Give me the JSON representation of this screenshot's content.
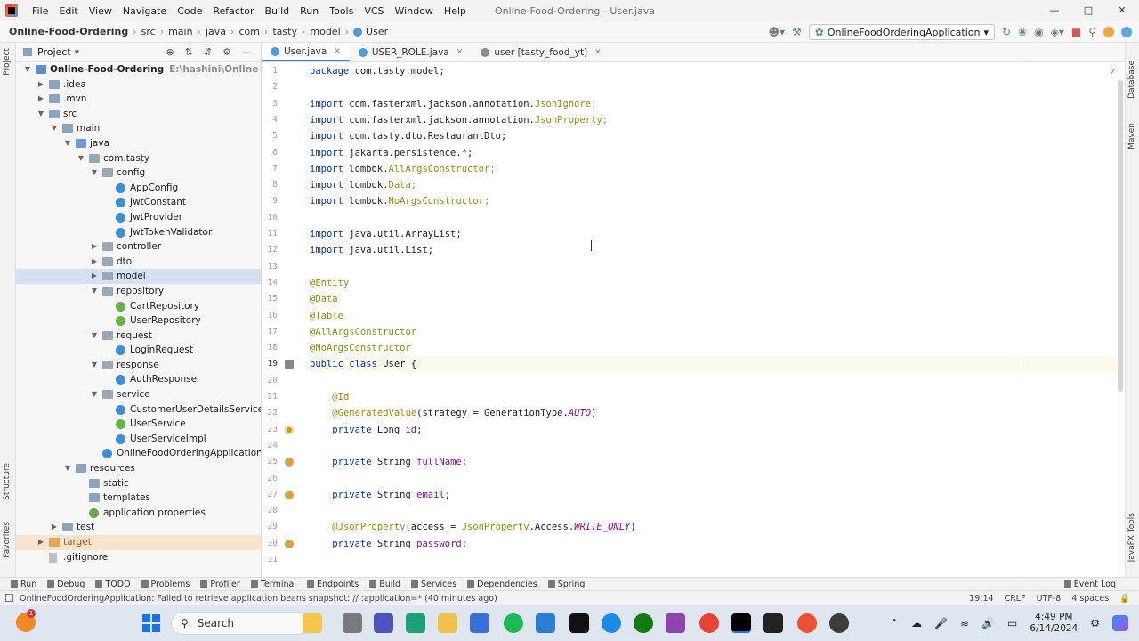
{
  "menu": [
    "File",
    "Edit",
    "View",
    "Navigate",
    "Code",
    "Refactor",
    "Build",
    "Run",
    "Tools",
    "VCS",
    "Window",
    "Help"
  ],
  "window_title": "Online-Food-Ordering - User.java",
  "breadcrumb": [
    "Online-Food-Ordering",
    "src",
    "main",
    "java",
    "com",
    "tasty",
    "model",
    "User"
  ],
  "run_config": "OnlineFoodOrderingApplication",
  "project_panel": {
    "title": "Project",
    "tree": [
      {
        "label": "Online-Food-Ordering",
        "hint": "E:\\hashini\\Online-Food-Orde",
        "depth": 0,
        "arrow": "open",
        "icon": "module",
        "bold": true
      },
      {
        "label": ".idea",
        "depth": 1,
        "arrow": "closed",
        "icon": "folder"
      },
      {
        "label": ".mvn",
        "depth": 1,
        "arrow": "closed",
        "icon": "folder"
      },
      {
        "label": "src",
        "depth": 1,
        "arrow": "open",
        "icon": "folder"
      },
      {
        "label": "main",
        "depth": 2,
        "arrow": "open",
        "icon": "folder"
      },
      {
        "label": "java",
        "depth": 3,
        "arrow": "open",
        "icon": "folder-blue"
      },
      {
        "label": "com.tasty",
        "depth": 4,
        "arrow": "open",
        "icon": "pkg"
      },
      {
        "label": "config",
        "depth": 5,
        "arrow": "open",
        "icon": "pkg"
      },
      {
        "label": "AppConfig",
        "depth": 6,
        "icon": "java"
      },
      {
        "label": "JwtConstant",
        "depth": 6,
        "icon": "java"
      },
      {
        "label": "JwtProvider",
        "depth": 6,
        "icon": "java"
      },
      {
        "label": "JwtTokenValidator",
        "depth": 6,
        "icon": "java"
      },
      {
        "label": "controller",
        "depth": 5,
        "arrow": "closed",
        "icon": "pkg"
      },
      {
        "label": "dto",
        "depth": 5,
        "arrow": "closed",
        "icon": "pkg"
      },
      {
        "label": "model",
        "depth": 5,
        "arrow": "closed",
        "icon": "pkg",
        "selected": true
      },
      {
        "label": "repository",
        "depth": 5,
        "arrow": "open",
        "icon": "pkg"
      },
      {
        "label": "CartRepository",
        "depth": 6,
        "icon": "iface"
      },
      {
        "label": "UserRepository",
        "depth": 6,
        "icon": "iface"
      },
      {
        "label": "request",
        "depth": 5,
        "arrow": "open",
        "icon": "pkg"
      },
      {
        "label": "LoginRequest",
        "depth": 6,
        "icon": "java"
      },
      {
        "label": "response",
        "depth": 5,
        "arrow": "open",
        "icon": "pkg"
      },
      {
        "label": "AuthResponse",
        "depth": 6,
        "icon": "java"
      },
      {
        "label": "service",
        "depth": 5,
        "arrow": "open",
        "icon": "pkg"
      },
      {
        "label": "CustomerUserDetailsService",
        "depth": 6,
        "icon": "java"
      },
      {
        "label": "UserService",
        "depth": 6,
        "icon": "iface"
      },
      {
        "label": "UserServiceImpl",
        "depth": 6,
        "icon": "java"
      },
      {
        "label": "OnlineFoodOrderingApplication",
        "depth": 5,
        "icon": "java"
      },
      {
        "label": "resources",
        "depth": 3,
        "arrow": "open",
        "icon": "folder"
      },
      {
        "label": "static",
        "depth": 4,
        "icon": "folder"
      },
      {
        "label": "templates",
        "depth": 4,
        "icon": "folder"
      },
      {
        "label": "application.properties",
        "depth": 4,
        "icon": "leaf"
      },
      {
        "label": "test",
        "depth": 2,
        "arrow": "closed",
        "icon": "folder"
      },
      {
        "label": "target",
        "depth": 1,
        "arrow": "closed",
        "icon": "folder-orange",
        "highlight": true
      },
      {
        "label": ".gitignore",
        "depth": 1,
        "icon": "file"
      }
    ]
  },
  "tabs": [
    {
      "label": "User.java",
      "active": true,
      "icon_color": "#4f9ad6"
    },
    {
      "label": "USER_ROLE.java",
      "active": false,
      "icon_color": "#4f9ad6"
    },
    {
      "label": "user [tasty_food_yt]",
      "active": false,
      "icon_color": "#8c8c8c"
    }
  ],
  "code": {
    "current_line": 19,
    "lines": [
      [
        [
          "kw",
          "package"
        ],
        [
          "p",
          " com.tasty.model;"
        ]
      ],
      [],
      [
        [
          "kw",
          "import"
        ],
        [
          "p",
          " com.fasterxml.jackson.annotation."
        ],
        [
          "ann",
          "JsonIgnore"
        ],
        [
          "grey",
          ";"
        ]
      ],
      [
        [
          "kw",
          "import"
        ],
        [
          "p",
          " com.fasterxml.jackson.annotation."
        ],
        [
          "ann",
          "JsonProperty"
        ],
        [
          "grey",
          ";"
        ]
      ],
      [
        [
          "kw",
          "import"
        ],
        [
          "p",
          " com.tasty.dto.RestaurantDto;"
        ]
      ],
      [
        [
          "kw",
          "import"
        ],
        [
          "p",
          " jakarta.persistence.*;"
        ]
      ],
      [
        [
          "kw",
          "import"
        ],
        [
          "p",
          " lombok."
        ],
        [
          "ann",
          "AllArgsConstructor"
        ],
        [
          "grey",
          ";"
        ]
      ],
      [
        [
          "kw",
          "import"
        ],
        [
          "p",
          " lombok."
        ],
        [
          "ann",
          "Data"
        ],
        [
          "grey",
          ";"
        ]
      ],
      [
        [
          "kw",
          "import"
        ],
        [
          "p",
          " lombok."
        ],
        [
          "ann",
          "NoArgsConstructor"
        ],
        [
          "grey",
          ";"
        ]
      ],
      [],
      [
        [
          "kw",
          "import"
        ],
        [
          "p",
          " java.util.ArrayList;"
        ]
      ],
      [
        [
          "kw",
          "import"
        ],
        [
          "p",
          " java.util.List;"
        ]
      ],
      [],
      [
        [
          "ann",
          "@Entity"
        ]
      ],
      [
        [
          "ann",
          "@Data"
        ]
      ],
      [
        [
          "ann",
          "@Table"
        ]
      ],
      [
        [
          "ann",
          "@AllArgsConstructor"
        ]
      ],
      [
        [
          "ann",
          "@NoArgsConstructor"
        ]
      ],
      [
        [
          "kw",
          "public class "
        ],
        [
          "p",
          "User {"
        ]
      ],
      [],
      [
        [
          "p",
          "    "
        ],
        [
          "ann",
          "@Id"
        ]
      ],
      [
        [
          "p",
          "    "
        ],
        [
          "ann",
          "@GeneratedValue"
        ],
        [
          "p",
          "(strategy = GenerationType."
        ],
        [
          "fld ital",
          "AUTO"
        ],
        [
          "p",
          ")"
        ]
      ],
      [
        [
          "p",
          "    "
        ],
        [
          "kw",
          "private "
        ],
        [
          "p",
          "Long "
        ],
        [
          "fld",
          "id"
        ],
        [
          "p",
          ";"
        ]
      ],
      [],
      [
        [
          "p",
          "    "
        ],
        [
          "kw",
          "private "
        ],
        [
          "p",
          "String "
        ],
        [
          "fld",
          "fullName"
        ],
        [
          "p",
          ";"
        ]
      ],
      [],
      [
        [
          "p",
          "    "
        ],
        [
          "kw",
          "private "
        ],
        [
          "p",
          "String "
        ],
        [
          "fld",
          "email"
        ],
        [
          "p",
          ";"
        ]
      ],
      [],
      [
        [
          "p",
          "    "
        ],
        [
          "ann",
          "@JsonProperty"
        ],
        [
          "p",
          "(access = "
        ],
        [
          "ann",
          "JsonProperty"
        ],
        [
          "p",
          ".Access."
        ],
        [
          "fld ital",
          "WRITE_ONLY"
        ],
        [
          "p",
          ")"
        ]
      ],
      [
        [
          "p",
          "    "
        ],
        [
          "kw",
          "private "
        ],
        [
          "p",
          "String "
        ],
        [
          "fld",
          "password"
        ],
        [
          "p",
          ";"
        ]
      ],
      []
    ],
    "gutter_icons": [
      23,
      25,
      27,
      30
    ]
  },
  "tool_windows": [
    "Run",
    "Debug",
    "TODO",
    "Problems",
    "Profiler",
    "Terminal",
    "Endpoints",
    "Build",
    "Services",
    "Dependencies",
    "Spring"
  ],
  "event_log": "Event Log",
  "status": {
    "message": "OnlineFoodOrderingApplication: Failed to retrieve application beans snapshot: // :application=* (40 minutes ago)",
    "position": "19:14",
    "line_sep": "CRLF",
    "encoding": "UTF-8",
    "indent": "4 spaces"
  },
  "side_tabs": {
    "left_top": "Project",
    "left_mid": "Structure",
    "left_bottom": "Favorites",
    "right_top": "Database",
    "right_mid": "Maven",
    "right_bottom": "JavaFX Tools"
  },
  "taskbar": {
    "search": "Search",
    "badge": "1",
    "time": "4:49 PM",
    "date": "6/14/2024"
  }
}
